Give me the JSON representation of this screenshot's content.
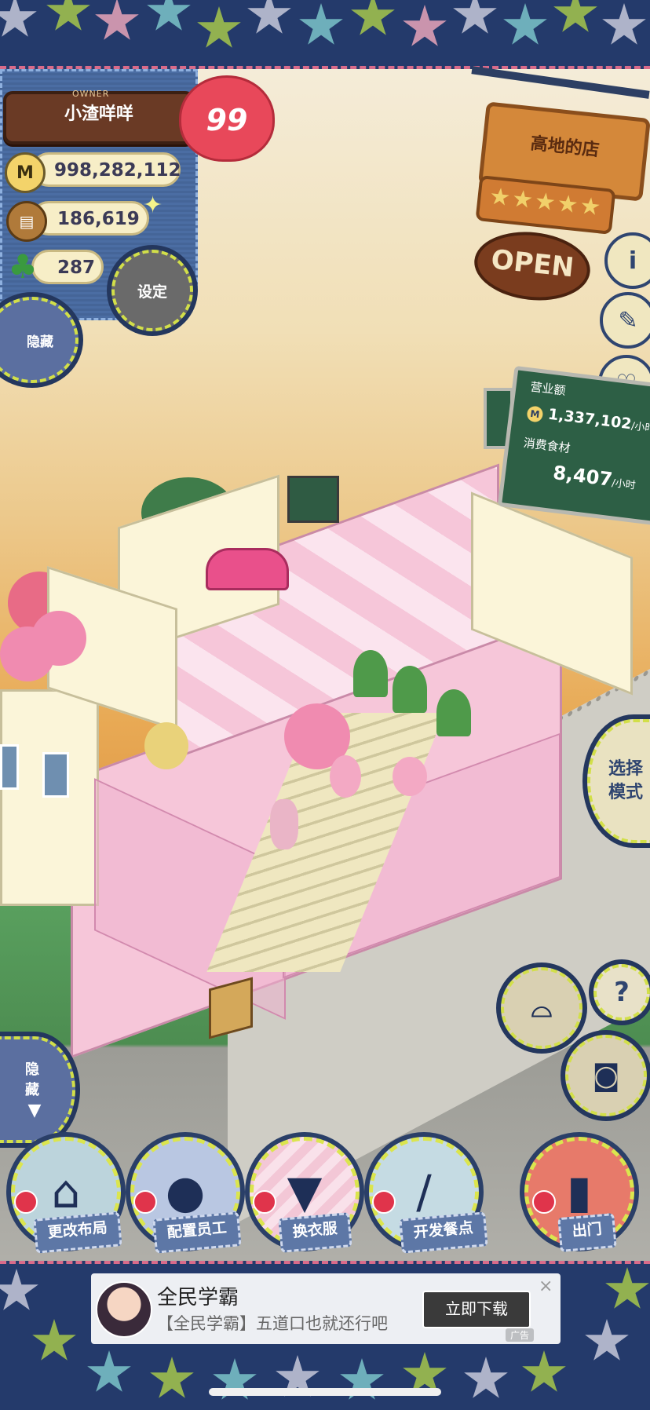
{
  "hud": {
    "owner_caption": "OWNER",
    "owner_name": "小渣咩咩",
    "level": "99",
    "money": "998,282,112",
    "money_icon": "M",
    "ingredients": "186,619",
    "clovers": "287",
    "settings_label": "设定",
    "hide_top_label": "隐藏",
    "hide_bottom_label": "隐藏"
  },
  "shop": {
    "name": "高地的店",
    "rating_stars": "★★★★★",
    "status": "OPEN"
  },
  "side_icons": {
    "info": "i",
    "book": "✎",
    "chat": "♡"
  },
  "board": {
    "revenue_label": "营业额",
    "revenue_value": "1,337,102",
    "revenue_unit": "/小时",
    "consume_label": "消费食材",
    "consume_value": "8,407",
    "consume_unit": "/小时"
  },
  "mode_button": "选择模式",
  "help_label": "?",
  "menu": [
    {
      "label": "更改布局",
      "icon": "table-icon"
    },
    {
      "label": "配置员工",
      "icon": "bear-icon"
    },
    {
      "label": "换衣服",
      "icon": "shirt-icon"
    },
    {
      "label": "开发餐点",
      "icon": "knife-icon"
    },
    {
      "label": "出门",
      "icon": "door-icon"
    }
  ],
  "ad": {
    "title": "全民学霸",
    "description": "【全民学霸】五道口也就还行吧",
    "button": "立即下载",
    "close": "×",
    "tag": "广告"
  }
}
